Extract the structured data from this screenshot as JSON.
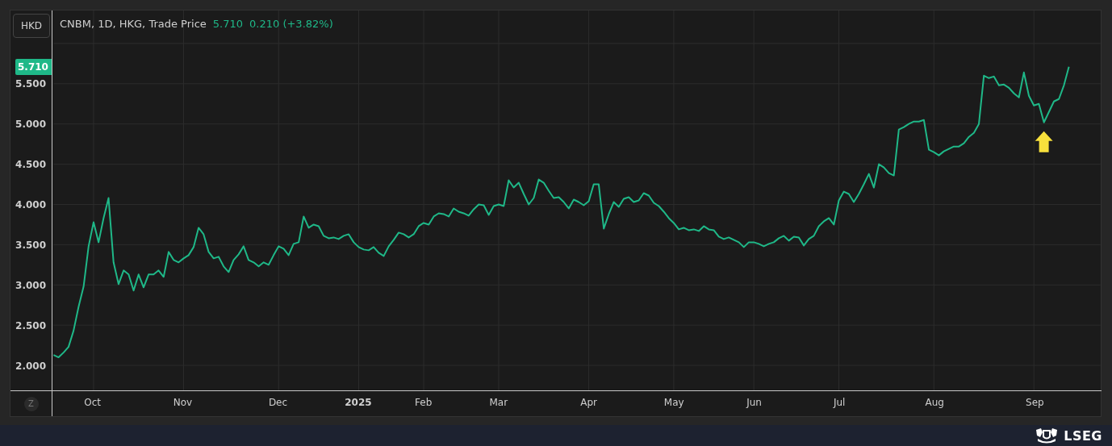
{
  "header": {
    "currency_button": "HKD",
    "title": "CNBM, 1D, HKG, Trade Price",
    "price": "5.710",
    "change": "0.210 (+3.82%)"
  },
  "chart": {
    "last_price_label": "5.710",
    "zoom_button": "Z",
    "marker": {
      "kind": "arrow"
    },
    "chart_data": {
      "type": "line",
      "grid": true,
      "ylim": [
        1.68,
        6.41
      ],
      "categories": [
        null,
        null,
        null,
        null,
        null,
        null,
        null,
        null,
        "Oct",
        null,
        null,
        null,
        null,
        null,
        null,
        null,
        null,
        null,
        null,
        null,
        null,
        null,
        null,
        null,
        null,
        null,
        "Nov",
        null,
        null,
        null,
        null,
        null,
        null,
        null,
        null,
        null,
        null,
        null,
        null,
        null,
        null,
        null,
        null,
        null,
        null,
        "Dec",
        null,
        null,
        null,
        null,
        null,
        null,
        null,
        null,
        null,
        null,
        null,
        null,
        null,
        null,
        null,
        "2025",
        null,
        null,
        null,
        null,
        null,
        null,
        null,
        null,
        null,
        null,
        null,
        null,
        "Feb",
        null,
        null,
        null,
        null,
        null,
        null,
        null,
        null,
        null,
        null,
        null,
        null,
        null,
        null,
        "Mar",
        null,
        null,
        null,
        null,
        null,
        null,
        null,
        null,
        null,
        null,
        null,
        null,
        null,
        null,
        null,
        null,
        null,
        "Apr",
        null,
        null,
        null,
        null,
        null,
        null,
        null,
        null,
        null,
        null,
        null,
        null,
        null,
        null,
        null,
        null,
        "May",
        null,
        null,
        null,
        null,
        null,
        null,
        null,
        null,
        null,
        null,
        null,
        null,
        null,
        null,
        null,
        "Jun",
        null,
        null,
        null,
        null,
        null,
        null,
        null,
        null,
        null,
        null,
        null,
        null,
        null,
        null,
        null,
        null,
        "Jul",
        null,
        null,
        null,
        null,
        null,
        null,
        null,
        null,
        null,
        null,
        null,
        null,
        null,
        null,
        null,
        null,
        null,
        null,
        "Aug",
        null,
        null,
        null,
        null,
        null,
        null,
        null,
        null,
        null,
        null,
        null,
        null,
        null,
        null,
        null,
        null,
        null,
        null,
        null,
        "Sep",
        null,
        null,
        null,
        null,
        null,
        null,
        null
      ],
      "series": [
        {
          "color": "#1fb888",
          "values": [
            2.13,
            2.1,
            2.16,
            2.23,
            2.43,
            2.73,
            2.98,
            3.48,
            3.78,
            3.53,
            3.83,
            4.08,
            3.28,
            3.01,
            3.18,
            3.13,
            2.93,
            3.13,
            2.97,
            3.13,
            3.13,
            3.18,
            3.1,
            3.41,
            3.31,
            3.28,
            3.33,
            3.37,
            3.47,
            3.71,
            3.63,
            3.41,
            3.33,
            3.35,
            3.23,
            3.16,
            3.31,
            3.38,
            3.48,
            3.31,
            3.28,
            3.23,
            3.28,
            3.25,
            3.37,
            3.48,
            3.45,
            3.37,
            3.51,
            3.53,
            3.85,
            3.71,
            3.75,
            3.73,
            3.61,
            3.58,
            3.59,
            3.57,
            3.61,
            3.63,
            3.53,
            3.47,
            3.44,
            3.43,
            3.47,
            3.4,
            3.36,
            3.48,
            3.56,
            3.65,
            3.63,
            3.59,
            3.63,
            3.73,
            3.77,
            3.75,
            3.85,
            3.89,
            3.88,
            3.85,
            3.95,
            3.91,
            3.89,
            3.86,
            3.94,
            4.0,
            3.99,
            3.87,
            3.98,
            4.0,
            3.98,
            4.3,
            4.21,
            4.27,
            4.13,
            4.0,
            4.08,
            4.31,
            4.27,
            4.17,
            4.08,
            4.09,
            4.03,
            3.95,
            4.06,
            4.03,
            3.99,
            4.04,
            4.25,
            4.25,
            3.7,
            3.88,
            4.03,
            3.97,
            4.07,
            4.09,
            4.03,
            4.05,
            4.14,
            4.11,
            4.02,
            3.98,
            3.91,
            3.83,
            3.77,
            3.69,
            3.71,
            3.68,
            3.69,
            3.67,
            3.73,
            3.69,
            3.68,
            3.6,
            3.57,
            3.59,
            3.56,
            3.53,
            3.47,
            3.53,
            3.53,
            3.51,
            3.48,
            3.51,
            3.53,
            3.58,
            3.61,
            3.55,
            3.6,
            3.59,
            3.49,
            3.57,
            3.61,
            3.73,
            3.79,
            3.83,
            3.75,
            4.05,
            4.16,
            4.13,
            4.03,
            4.13,
            4.25,
            4.38,
            4.21,
            4.5,
            4.46,
            4.39,
            4.36,
            4.93,
            4.96,
            5.0,
            5.03,
            5.03,
            5.05,
            4.68,
            4.65,
            4.61,
            4.66,
            4.69,
            4.72,
            4.72,
            4.76,
            4.84,
            4.89,
            5.0,
            5.6,
            5.57,
            5.59,
            5.48,
            5.49,
            5.45,
            5.38,
            5.33,
            5.64,
            5.35,
            5.23,
            5.25,
            5.02,
            5.15,
            5.28,
            5.31,
            5.48,
            5.71
          ]
        }
      ],
      "yticks": [
        {
          "value": 2,
          "label": "2.000"
        },
        {
          "value": 2.5,
          "label": "2.500"
        },
        {
          "value": 3,
          "label": "3.000"
        },
        {
          "value": 3.5,
          "label": "3.500"
        },
        {
          "value": 4,
          "label": "4.000"
        },
        {
          "value": 4.5,
          "label": "4.500"
        },
        {
          "value": 5,
          "label": "5.000"
        },
        {
          "value": 5.5,
          "label": "5.500"
        }
      ]
    }
  },
  "footer": {
    "brand": "LSEG"
  }
}
